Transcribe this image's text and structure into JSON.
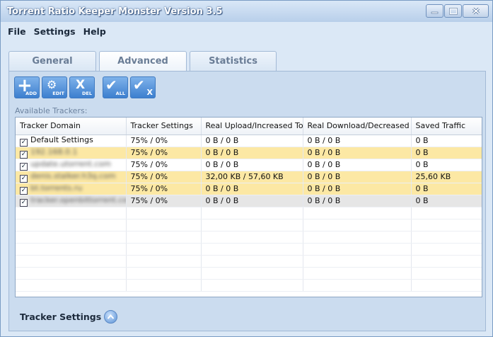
{
  "window": {
    "title": "Torrent Ratio Keeper Monster Version 3.5",
    "controls": [
      "minimize-icon",
      "maximize-icon",
      "close-icon"
    ]
  },
  "menu": {
    "items": [
      "File",
      "Settings",
      "Help"
    ]
  },
  "tabs": [
    {
      "label": "General"
    },
    {
      "label": "Advanced",
      "active": true
    },
    {
      "label": "Statistics"
    }
  ],
  "toolbar": {
    "add": {
      "glyph": "+",
      "label": "ADD",
      "icon": "plus-icon"
    },
    "edit": {
      "glyph": "⚙",
      "label": "EDIT",
      "icon": "gear-icon"
    },
    "del": {
      "glyph": "X",
      "label": "DEL",
      "icon": "delete-icon"
    },
    "check_all": {
      "glyph": "✔",
      "label": "ALL",
      "icon": "check-all-icon"
    },
    "uncheck": {
      "glyph": "✔",
      "label": "X",
      "icon": "uncheck-icon"
    }
  },
  "trackers": {
    "label": "Available Trackers:",
    "columns": [
      "Tracker Domain",
      "Tracker Settings",
      "Real Upload/Increased To",
      "Real Download/Decreased To",
      "Saved Traffic"
    ],
    "rows": [
      {
        "domain": "Default Settings",
        "settings": "75% / 0%",
        "upload": "0 B / 0 B",
        "download": "0 B / 0 B",
        "saved": "0 B",
        "checked": true,
        "style": "normal",
        "blurred": false
      },
      {
        "domain": "192.168.0.1",
        "settings": "75% / 0%",
        "upload": "0 B / 0 B",
        "download": "0 B / 0 B",
        "saved": "0 B",
        "checked": true,
        "style": "hl",
        "blurred": true
      },
      {
        "domain": "update.utorrent.com",
        "settings": "75% / 0%",
        "upload": "0 B / 0 B",
        "download": "0 B / 0 B",
        "saved": "0 B",
        "checked": true,
        "style": "normal",
        "blurred": true
      },
      {
        "domain": "denis.stalker.h3q.com",
        "settings": "75% / 0%",
        "upload": "32,00 KB / 57,60 KB",
        "download": "0 B / 0 B",
        "saved": "25,60 KB",
        "checked": true,
        "style": "hl",
        "blurred": true
      },
      {
        "domain": "bt.torrents.ru",
        "settings": "75% / 0%",
        "upload": "0 B / 0 B",
        "download": "0 B / 0 B",
        "saved": "0 B",
        "checked": true,
        "style": "hl",
        "blurred": true
      },
      {
        "domain": "tracker.openbittorrent.com",
        "settings": "75% / 0%",
        "upload": "0 B / 0 B",
        "download": "0 B / 0 B",
        "saved": "0 B",
        "checked": true,
        "style": "sel",
        "blurred": true
      }
    ],
    "empty_rows": 7
  },
  "settings_section": {
    "label": "Tracker Settings",
    "icon": "chevron-up-icon"
  }
}
